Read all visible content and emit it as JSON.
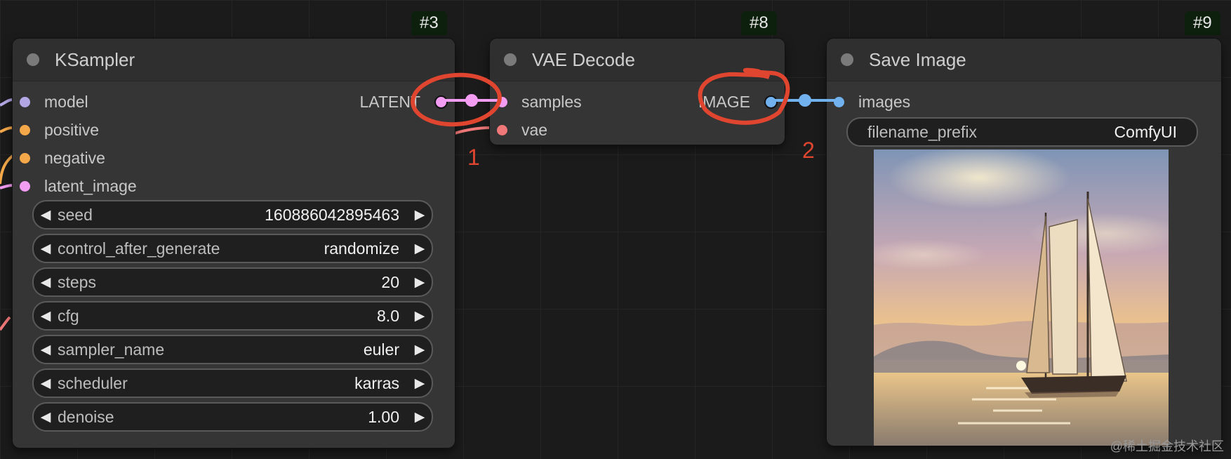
{
  "nodes": {
    "ksampler": {
      "id": "#3",
      "title": "KSampler",
      "inputs": [
        "model",
        "positive",
        "negative",
        "latent_image"
      ],
      "output": "LATENT",
      "widgets": [
        {
          "label": "seed",
          "value": "160886042895463"
        },
        {
          "label": "control_after_generate",
          "value": "randomize"
        },
        {
          "label": "steps",
          "value": "20"
        },
        {
          "label": "cfg",
          "value": "8.0"
        },
        {
          "label": "sampler_name",
          "value": "euler"
        },
        {
          "label": "scheduler",
          "value": "karras"
        },
        {
          "label": "denoise",
          "value": "1.00"
        }
      ]
    },
    "vae_decode": {
      "id": "#8",
      "title": "VAE Decode",
      "inputs": [
        "samples",
        "vae"
      ],
      "output": "IMAGE"
    },
    "save_image": {
      "id": "#9",
      "title": "Save Image",
      "input": "images",
      "filename_prefix_label": "filename_prefix",
      "filename_prefix_value": "ComfyUI"
    }
  },
  "annotations": [
    "1",
    "2"
  ],
  "watermark": "@稀土掘金技术社区",
  "colors": {
    "model": "#b4a7e6",
    "clip_conditioning": "#f5a84a",
    "latent": "#f29cf2",
    "vae": "#f07878",
    "image": "#70b1ee",
    "annotation": "#e0452f",
    "badge_bg": "#0d1f0d"
  },
  "icons": {
    "decrement": "left-triangle",
    "increment": "right-triangle"
  }
}
